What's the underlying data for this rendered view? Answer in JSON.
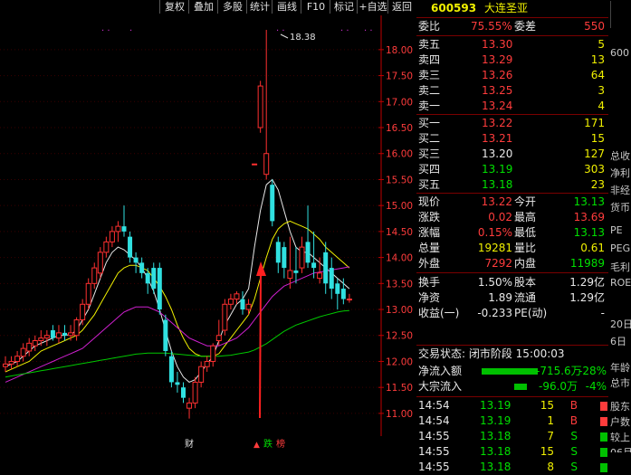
{
  "toolbar": {
    "buttons": [
      "复权",
      "叠加",
      "多股",
      "统计",
      "画线",
      "F10",
      "标记",
      "+自选",
      "返回"
    ]
  },
  "chart": {
    "price_labels": [
      "18.00",
      "17.50",
      "17.00",
      "16.50",
      "16.00",
      "15.50",
      "15.00",
      "14.50",
      "14.00",
      "13.50",
      "13.00",
      "12.50",
      "12.00",
      "11.50",
      "11.00"
    ],
    "high_marker": "18.38",
    "bottom_markers": {
      "cai": "财",
      "zhang": "涨",
      "die": "跌",
      "bang": "榜"
    }
  },
  "chart_data": {
    "type": "candlestick",
    "ylim": [
      10.65,
      18.52
    ],
    "candles": [
      {
        "o": 11.9,
        "c": 11.95,
        "h": 12.1,
        "l": 11.8
      },
      {
        "o": 11.95,
        "c": 12.0,
        "h": 12.1,
        "l": 11.85
      },
      {
        "o": 12.0,
        "c": 12.1,
        "h": 12.2,
        "l": 11.9
      },
      {
        "o": 12.1,
        "c": 12.25,
        "h": 12.35,
        "l": 12.0
      },
      {
        "o": 12.2,
        "c": 12.35,
        "h": 12.45,
        "l": 12.1
      },
      {
        "o": 12.3,
        "c": 12.4,
        "h": 12.5,
        "l": 12.2
      },
      {
        "o": 12.4,
        "c": 12.45,
        "h": 12.6,
        "l": 12.3
      },
      {
        "o": 12.45,
        "c": 12.5,
        "h": 12.6,
        "l": 12.3
      },
      {
        "o": 12.6,
        "c": 12.45,
        "h": 12.7,
        "l": 12.4
      },
      {
        "o": 12.45,
        "c": 12.55,
        "h": 12.7,
        "l": 12.35
      },
      {
        "o": 12.55,
        "c": 12.5,
        "h": 12.7,
        "l": 12.4
      },
      {
        "o": 12.5,
        "c": 12.55,
        "h": 12.7,
        "l": 12.4
      },
      {
        "o": 12.5,
        "c": 12.8,
        "h": 12.85,
        "l": 12.4
      },
      {
        "o": 12.8,
        "c": 13.1,
        "h": 13.2,
        "l": 12.7
      },
      {
        "o": 13.1,
        "c": 13.5,
        "h": 13.6,
        "l": 13.0
      },
      {
        "o": 13.5,
        "c": 13.8,
        "h": 13.9,
        "l": 13.4
      },
      {
        "o": 13.7,
        "c": 14.1,
        "h": 14.2,
        "l": 13.6
      },
      {
        "o": 14.1,
        "c": 14.3,
        "h": 14.4,
        "l": 14.0
      },
      {
        "o": 14.3,
        "c": 14.5,
        "h": 14.6,
        "l": 14.2
      },
      {
        "o": 14.5,
        "c": 14.6,
        "h": 14.7,
        "l": 14.3
      },
      {
        "o": 14.6,
        "c": 14.5,
        "h": 15.0,
        "l": 14.4
      },
      {
        "o": 14.4,
        "c": 14.0,
        "h": 14.5,
        "l": 13.9
      },
      {
        "o": 14.0,
        "c": 13.9,
        "h": 14.1,
        "l": 13.7
      },
      {
        "o": 13.9,
        "c": 13.7,
        "h": 14.0,
        "l": 13.6
      },
      {
        "o": 13.7,
        "c": 13.5,
        "h": 13.8,
        "l": 13.3
      },
      {
        "o": 13.8,
        "c": 13.4,
        "h": 13.9,
        "l": 13.3
      },
      {
        "o": 13.8,
        "c": 13.0,
        "h": 13.9,
        "l": 12.9
      },
      {
        "o": 12.8,
        "c": 12.2,
        "h": 12.9,
        "l": 12.1
      },
      {
        "o": 12.1,
        "c": 11.6,
        "h": 12.2,
        "l": 11.5
      },
      {
        "o": 11.6,
        "c": 11.55,
        "h": 11.8,
        "l": 11.4
      },
      {
        "o": 11.5,
        "c": 11.3,
        "h": 11.6,
        "l": 11.2
      },
      {
        "o": 11.1,
        "c": 11.2,
        "h": 11.3,
        "l": 10.9
      },
      {
        "o": 11.2,
        "c": 11.6,
        "h": 11.7,
        "l": 11.1
      },
      {
        "o": 11.6,
        "c": 11.9,
        "h": 12.0,
        "l": 11.5
      },
      {
        "o": 11.9,
        "c": 12.0,
        "h": 12.1,
        "l": 11.8
      },
      {
        "o": 12.0,
        "c": 12.3,
        "h": 12.35,
        "l": 11.9
      },
      {
        "o": 12.4,
        "c": 12.5,
        "h": 12.8,
        "l": 12.3
      },
      {
        "o": 12.6,
        "c": 13.1,
        "h": 13.2,
        "l": 12.5
      },
      {
        "o": 13.1,
        "c": 13.2,
        "h": 13.3,
        "l": 13.0
      },
      {
        "o": 13.2,
        "c": 13.3,
        "h": 13.35,
        "l": 13.1
      },
      {
        "o": 13.2,
        "c": 13.0,
        "h": 13.35,
        "l": 12.9
      },
      {
        "o": 13.0,
        "c": 13.1,
        "h": 13.2,
        "l": 12.9
      },
      {
        "o": 15.8,
        "c": 15.8,
        "h": 15.8,
        "l": 15.8
      },
      {
        "o": 16.5,
        "c": 17.3,
        "h": 17.4,
        "l": 16.4
      },
      {
        "o": 15.6,
        "c": 16.0,
        "h": 18.38,
        "l": 15.5
      },
      {
        "o": 15.4,
        "c": 14.7,
        "h": 15.5,
        "l": 14.6
      },
      {
        "o": 14.3,
        "c": 13.9,
        "h": 14.4,
        "l": 13.7
      },
      {
        "o": 14.2,
        "c": 13.8,
        "h": 14.3,
        "l": 13.6
      },
      {
        "o": 13.6,
        "c": 13.75,
        "h": 14.4,
        "l": 13.4
      },
      {
        "o": 13.75,
        "c": 13.7,
        "h": 14.2,
        "l": 13.5
      },
      {
        "o": 13.8,
        "c": 14.2,
        "h": 14.4,
        "l": 13.7
      },
      {
        "o": 14.3,
        "c": 13.9,
        "h": 15.0,
        "l": 13.8
      },
      {
        "o": 13.9,
        "c": 13.8,
        "h": 14.5,
        "l": 13.6
      },
      {
        "o": 13.6,
        "c": 13.7,
        "h": 14.0,
        "l": 13.5
      },
      {
        "o": 14.1,
        "c": 13.5,
        "h": 14.3,
        "l": 13.3
      },
      {
        "o": 13.8,
        "c": 13.4,
        "h": 14.0,
        "l": 13.2
      },
      {
        "o": 13.5,
        "c": 13.3,
        "h": 13.6,
        "l": 13.0
      },
      {
        "o": 13.4,
        "c": 13.2,
        "h": 13.6,
        "l": 13.1
      },
      {
        "o": 13.2,
        "c": 13.2,
        "h": 13.3,
        "l": 13.13
      }
    ],
    "ma_lines": [
      {
        "color": "#e8e8e8",
        "values": [
          11.9,
          11.95,
          12.0,
          12.1,
          12.2,
          12.3,
          12.35,
          12.4,
          12.45,
          12.5,
          12.5,
          12.52,
          12.6,
          12.8,
          13.0,
          13.3,
          13.6,
          13.9,
          14.1,
          14.2,
          14.15,
          14.05,
          13.95,
          13.8,
          13.6,
          13.35,
          13.0,
          12.6,
          12.2,
          11.9,
          11.7,
          11.6,
          11.65,
          11.8,
          11.95,
          12.1,
          12.4,
          12.7,
          12.9,
          13.1,
          13.2,
          13.4,
          14.2,
          14.9,
          15.4,
          15.5,
          15.3,
          14.9,
          14.5,
          14.2,
          14.1,
          14.1,
          14.0,
          13.9,
          13.8,
          13.7,
          13.6,
          13.5,
          13.4
        ]
      },
      {
        "color": "#f0f000",
        "values": [
          11.8,
          11.85,
          11.9,
          11.95,
          12.0,
          12.1,
          12.2,
          12.25,
          12.3,
          12.35,
          12.4,
          12.45,
          12.5,
          12.6,
          12.75,
          12.9,
          13.1,
          13.3,
          13.5,
          13.7,
          13.8,
          13.85,
          13.85,
          13.8,
          13.75,
          13.6,
          13.45,
          13.25,
          13.0,
          12.7,
          12.45,
          12.25,
          12.15,
          12.1,
          12.1,
          12.1,
          12.15,
          12.3,
          12.45,
          12.6,
          12.75,
          12.9,
          13.2,
          13.6,
          14.0,
          14.35,
          14.55,
          14.65,
          14.7,
          14.65,
          14.6,
          14.55,
          14.45,
          14.35,
          14.2,
          14.1,
          14.0,
          13.9,
          13.8
        ]
      },
      {
        "color": "#d020d0",
        "values": [
          11.6,
          11.65,
          11.7,
          11.75,
          11.8,
          11.85,
          11.9,
          11.95,
          12.0,
          12.05,
          12.1,
          12.15,
          12.2,
          12.25,
          12.35,
          12.45,
          12.55,
          12.65,
          12.75,
          12.85,
          12.95,
          13.0,
          13.05,
          13.05,
          13.05,
          13.0,
          12.95,
          12.85,
          12.75,
          12.65,
          12.55,
          12.45,
          12.4,
          12.35,
          12.3,
          12.3,
          12.3,
          12.35,
          12.4,
          12.45,
          12.55,
          12.65,
          12.8,
          12.95,
          13.1,
          13.25,
          13.35,
          13.45,
          13.5,
          13.55,
          13.6,
          13.65,
          13.7,
          13.72,
          13.74,
          13.76,
          13.78,
          13.8,
          13.82
        ]
      },
      {
        "color": "#00c800",
        "values": [
          11.7,
          11.72,
          11.74,
          11.76,
          11.78,
          11.8,
          11.82,
          11.84,
          11.86,
          11.88,
          11.9,
          11.92,
          11.94,
          11.96,
          11.98,
          12.0,
          12.02,
          12.04,
          12.06,
          12.08,
          12.1,
          12.12,
          12.14,
          12.15,
          12.16,
          12.16,
          12.16,
          12.16,
          12.15,
          12.14,
          12.13,
          12.12,
          12.11,
          12.1,
          12.1,
          12.1,
          12.1,
          12.11,
          12.12,
          12.14,
          12.16,
          12.18,
          12.22,
          12.28,
          12.34,
          12.42,
          12.5,
          12.58,
          12.64,
          12.7,
          12.74,
          12.78,
          12.82,
          12.86,
          12.89,
          12.92,
          12.95,
          12.97,
          12.98
        ]
      }
    ]
  },
  "quote": {
    "code": "600593",
    "name": "大连圣亚",
    "weibi_label": "委比",
    "weibi_value": "75.55%",
    "weicha_label": "委差",
    "weicha_value": "550",
    "asks": [
      {
        "label": "卖五",
        "price": "13.30",
        "vol": "5"
      },
      {
        "label": "卖四",
        "price": "13.29",
        "vol": "13"
      },
      {
        "label": "卖三",
        "price": "13.26",
        "vol": "64"
      },
      {
        "label": "卖二",
        "price": "13.25",
        "vol": "3"
      },
      {
        "label": "卖一",
        "price": "13.24",
        "vol": "4"
      }
    ],
    "bids": [
      {
        "label": "买一",
        "price": "13.22",
        "vol": "171"
      },
      {
        "label": "买二",
        "price": "13.21",
        "vol": "15"
      },
      {
        "label": "买三",
        "price": "13.20",
        "vol": "127"
      },
      {
        "label": "买四",
        "price": "13.19",
        "vol": "303"
      },
      {
        "label": "买五",
        "price": "13.18",
        "vol": "23"
      }
    ],
    "stats": [
      {
        "l1": "现价",
        "v1": "13.22",
        "c1": "red",
        "l2": "今开",
        "v2": "13.13",
        "c2": "green"
      },
      {
        "l1": "涨跌",
        "v1": "0.02",
        "c1": "red",
        "l2": "最高",
        "v2": "13.69",
        "c2": "red"
      },
      {
        "l1": "涨幅",
        "v1": "0.15%",
        "c1": "red",
        "l2": "最低",
        "v2": "13.13",
        "c2": "green"
      },
      {
        "l1": "总量",
        "v1": "19281",
        "c1": "yellow",
        "l2": "量比",
        "v2": "0.61",
        "c2": "yellow"
      },
      {
        "l1": "外盘",
        "v1": "7292",
        "c1": "red",
        "l2": "内盘",
        "v2": "11989",
        "c2": "green"
      }
    ],
    "stats2": [
      {
        "l1": "换手",
        "v1": "1.50%",
        "l2": "股本",
        "v2": "1.29亿"
      },
      {
        "l1": "净资",
        "v1": "1.89",
        "l2": "流通",
        "v2": "1.29亿"
      },
      {
        "l1": "收益(一)",
        "v1": "-0.233",
        "l2": "PE(动)",
        "v2": "-"
      }
    ],
    "trade_status": "交易状态: 闭市阶段 15:00:03",
    "net_inflow_label": "净流入额",
    "net_inflow_value": "-715.6万",
    "net_inflow_pct": "-28%",
    "block_label": "大宗流入",
    "block_value": "-96.0万",
    "block_pct": "-4%",
    "ticks": [
      {
        "t": "14:54",
        "p": "13.19",
        "v": "15",
        "s": "B"
      },
      {
        "t": "14:54",
        "p": "13.19",
        "v": "1",
        "s": "B"
      },
      {
        "t": "14:55",
        "p": "13.18",
        "v": "7",
        "s": "S"
      },
      {
        "t": "14:55",
        "p": "13.18",
        "v": "15",
        "s": "S"
      },
      {
        "t": "14:55",
        "p": "13.18",
        "v": "8",
        "s": "S"
      }
    ]
  },
  "side_panel": {
    "texts": [
      "600",
      "总收",
      "净利",
      "非经",
      "货币",
      "PE",
      "PEG",
      "毛利",
      "ROE",
      "20日",
      "6日",
      "年龄",
      "总市",
      "股东",
      "户数",
      "较上",
      "06月"
    ]
  }
}
